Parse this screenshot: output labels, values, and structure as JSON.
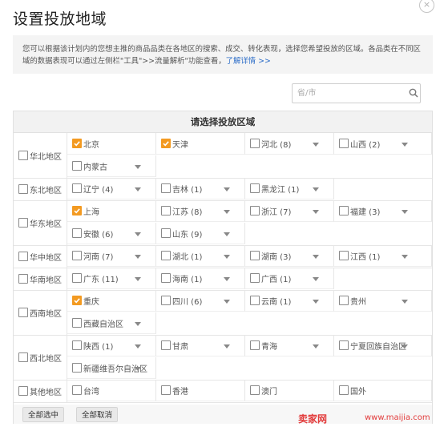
{
  "dialog": {
    "title": "设置投放地域",
    "close_glyph": "×",
    "notice_text": "您可以根据该计划内的您想主推的商品品类在各地区的搜索、成交、转化表现，选择您希望投放的区域。各品类在不同区域的数据表现可以通过左侧栏\"工具\">>流量解析\"功能查看，",
    "notice_link": "了解详情 >>",
    "search_placeholder": "省/市",
    "table_header": "请选择投放区域",
    "select_all_label": "全部选中",
    "deselect_all_label": "全部取消"
  },
  "regions": [
    {
      "name": "华北地区",
      "checked": false,
      "provinces": [
        {
          "label": "北京",
          "checked": true,
          "dropdown": false
        },
        {
          "label": "天津",
          "checked": true,
          "dropdown": false
        },
        {
          "label": "河北 (8)",
          "checked": false,
          "dropdown": true
        },
        {
          "label": "山西 (2)",
          "checked": false,
          "dropdown": true
        },
        {
          "label": "内蒙古",
          "checked": false,
          "dropdown": true
        }
      ]
    },
    {
      "name": "东北地区",
      "checked": false,
      "provinces": [
        {
          "label": "辽宁 (4)",
          "checked": false,
          "dropdown": true
        },
        {
          "label": "吉林 (1)",
          "checked": false,
          "dropdown": true
        },
        {
          "label": "黑龙江 (1)",
          "checked": false,
          "dropdown": true
        }
      ]
    },
    {
      "name": "华东地区",
      "checked": false,
      "provinces": [
        {
          "label": "上海",
          "checked": true,
          "dropdown": false
        },
        {
          "label": "江苏 (8)",
          "checked": false,
          "dropdown": true
        },
        {
          "label": "浙江 (7)",
          "checked": false,
          "dropdown": true
        },
        {
          "label": "福建 (3)",
          "checked": false,
          "dropdown": true
        },
        {
          "label": "安徽 (6)",
          "checked": false,
          "dropdown": true
        },
        {
          "label": "山东 (9)",
          "checked": false,
          "dropdown": true
        }
      ]
    },
    {
      "name": "华中地区",
      "checked": false,
      "provinces": [
        {
          "label": "河南 (7)",
          "checked": false,
          "dropdown": true
        },
        {
          "label": "湖北 (1)",
          "checked": false,
          "dropdown": true
        },
        {
          "label": "湖南 (3)",
          "checked": false,
          "dropdown": true
        },
        {
          "label": "江西 (1)",
          "checked": false,
          "dropdown": true
        }
      ]
    },
    {
      "name": "华南地区",
      "checked": false,
      "provinces": [
        {
          "label": "广东 (11)",
          "checked": false,
          "dropdown": true
        },
        {
          "label": "海南 (1)",
          "checked": false,
          "dropdown": true
        },
        {
          "label": "广西 (1)",
          "checked": false,
          "dropdown": true
        }
      ]
    },
    {
      "name": "西南地区",
      "checked": false,
      "provinces": [
        {
          "label": "重庆",
          "checked": true,
          "dropdown": false
        },
        {
          "label": "四川 (6)",
          "checked": false,
          "dropdown": true
        },
        {
          "label": "云南 (1)",
          "checked": false,
          "dropdown": true
        },
        {
          "label": "贵州",
          "checked": false,
          "dropdown": true
        },
        {
          "label": "西藏自治区",
          "checked": false,
          "dropdown": true
        }
      ]
    },
    {
      "name": "西北地区",
      "checked": false,
      "provinces": [
        {
          "label": "陕西 (1)",
          "checked": false,
          "dropdown": true
        },
        {
          "label": "甘肃",
          "checked": false,
          "dropdown": true
        },
        {
          "label": "青海",
          "checked": false,
          "dropdown": true
        },
        {
          "label": "宁夏回族自治区",
          "checked": false,
          "dropdown": true
        },
        {
          "label": "新疆维吾尔自治区",
          "checked": false,
          "dropdown": true
        }
      ]
    },
    {
      "name": "其他地区",
      "checked": false,
      "provinces": [
        {
          "label": "台湾",
          "checked": false,
          "dropdown": false
        },
        {
          "label": "香港",
          "checked": false,
          "dropdown": false
        },
        {
          "label": "澳门",
          "checked": false,
          "dropdown": false
        },
        {
          "label": "国外",
          "checked": false,
          "dropdown": false
        }
      ]
    }
  ],
  "watermark": {
    "logo": "卖家网",
    "url": "www.maijia.com"
  },
  "colors": {
    "checked": "#f39a21",
    "link": "#2e6ec8",
    "watermark": "#e23b3b"
  }
}
